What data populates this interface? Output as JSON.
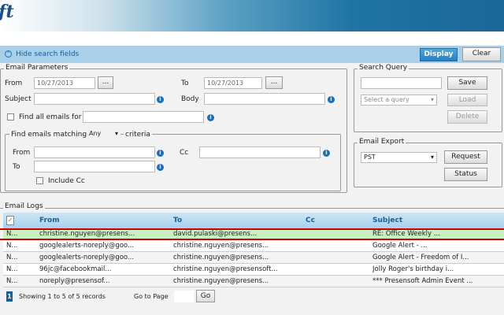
{
  "header": {
    "logo_text": "ft"
  },
  "toolbar": {
    "hide_label": "Hide search fields",
    "display": "Display",
    "clear": "Clear"
  },
  "params": {
    "legend": "Email Parameters",
    "from": "From",
    "from_date": "10/27/2013",
    "to": "To",
    "to_date": "10/27/2013",
    "browse": "...",
    "subject": "Subject",
    "body": "Body",
    "find_all": "Find all emails for",
    "criteria": {
      "prefix": "Find emails matching",
      "match": "Any",
      "suffix": "criteria",
      "from": "From",
      "cc": "Cc",
      "to": "To",
      "include_cc": "Include Cc"
    }
  },
  "query": {
    "legend": "Search Query",
    "save": "Save",
    "select_placeholder": "Select a query",
    "load": "Load",
    "delete": "Delete"
  },
  "export": {
    "legend": "Email Export",
    "format": "PST",
    "request": "Request",
    "status": "Status"
  },
  "logs": {
    "legend": "Email Logs",
    "columns": [
      "From",
      "To",
      "Cc",
      "Subject"
    ],
    "rows": [
      {
        "id": "N...",
        "from": "christine.nguyen@presens...",
        "to": "david.pulaski@presens...",
        "cc": "",
        "subject": "RE: Office Weekly ..."
      },
      {
        "id": "N...",
        "from": "googlealerts-noreply@goo...",
        "to": "christine.nguyen@presens...",
        "cc": "",
        "subject": "Google Alert - ..."
      },
      {
        "id": "N...",
        "from": "googlealerts-noreply@goo...",
        "to": "christine.nguyen@presens...",
        "cc": "",
        "subject": "Google Alert - Freedom of I..."
      },
      {
        "id": "N...",
        "from": "96jc@facebookmail...",
        "to": "christine.nguyen@presensoft...",
        "cc": "",
        "subject": "Jolly Roger's birthday i..."
      },
      {
        "id": "N...",
        "from": "noreply@presensof...",
        "to": "christine.nguyen@presens...",
        "cc": "",
        "subject": "*** Presensoft Admin Event ..."
      }
    ],
    "page": "1",
    "showing": "Showing 1 to 5 of 5 records",
    "goto": "Go to Page",
    "go": "Go"
  },
  "colors": {
    "accent": "#1a6fb8",
    "selected_row": "#c8f0c0",
    "highlight_border": "#cc0000"
  }
}
